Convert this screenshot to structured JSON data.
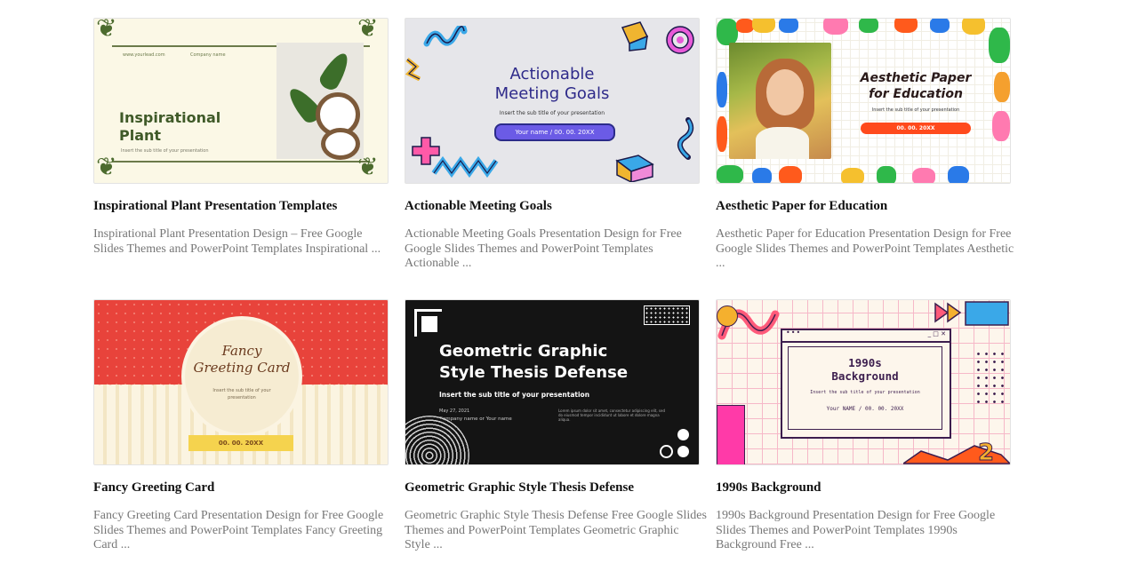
{
  "cards": [
    {
      "title": "Inspirational Plant Presentation Templates",
      "description": "Inspirational Plant Presentation Design – Free Google Slides Themes and PowerPoint Templates Inspirational ...",
      "thumb": {
        "url_text": "www.yourlead.com",
        "company_text": "Company name",
        "heading_line1": "Inspirational",
        "heading_line2": "Plant",
        "subtitle": "Insert the sub title of your presentation",
        "accent": "#4c6b2e"
      }
    },
    {
      "title": "Actionable Meeting Goals",
      "description": "Actionable Meeting Goals Presentation Design for Free Google Slides Themes and PowerPoint Templates Actionable ...",
      "thumb": {
        "heading_line1": "Actionable",
        "heading_line2": "Meeting Goals",
        "subtitle": "Insert the sub title of your presentation",
        "pill_text": "Your name / 00. 00. 20XX",
        "accent": "#3a36a8"
      }
    },
    {
      "title": "Aesthetic Paper for Education",
      "description": "Aesthetic Paper for Education Presentation Design for Free Google Slides Themes and PowerPoint Templates Aesthetic ...",
      "thumb": {
        "heading_line1": "Aesthetic Paper",
        "heading_line2": "for Education",
        "subtitle": "Insert the sub title of your presentation",
        "button_text": "00. 00. 20XX",
        "accent": "#ff4a1c"
      }
    },
    {
      "title": "Fancy Greeting Card",
      "description": "Fancy Greeting Card Presentation Design for Free Google Slides Themes and PowerPoint Templates Fancy Greeting Card ...",
      "thumb": {
        "heading_line1": "Fancy",
        "heading_line2": "Greeting Card",
        "subtitle_line1": "Insert the sub title of your",
        "subtitle_line2": "presentation",
        "ribbon_text": "00. 00. 20XX",
        "accent": "#e8433b"
      }
    },
    {
      "title": "Geometric Graphic Style Thesis Defense",
      "description": "Geometric Graphic Style Thesis Defense Free Google Slides Themes and PowerPoint Templates Geometric Graphic Style ...",
      "thumb": {
        "heading_line1": "Geometric Graphic",
        "heading_line2": "Style Thesis Defense",
        "subtitle": "Insert the sub title of your presentation",
        "date_text": "May 27, 2021",
        "company_text": "Company name or Your name",
        "lorem_text": "Lorem ipsum dolor sit amet, consectetur adipiscing elit, sed do eiusmod tempor incididunt ut labore et dolore magna aliqua.",
        "accent": "#141414"
      }
    },
    {
      "title": "1990s Background",
      "description": "1990s Background Presentation Design for Free Google Slides Themes and PowerPoint Templates 1990s Background Free ...",
      "thumb": {
        "heading_line1": "1990s",
        "heading_line2": "Background",
        "subtitle": "Insert the sub title of your presentation",
        "name_text": "Your NAME / 00. 00. 20XX",
        "window_controls": "_ □ ✕",
        "accent": "#3c1e4e"
      }
    }
  ]
}
